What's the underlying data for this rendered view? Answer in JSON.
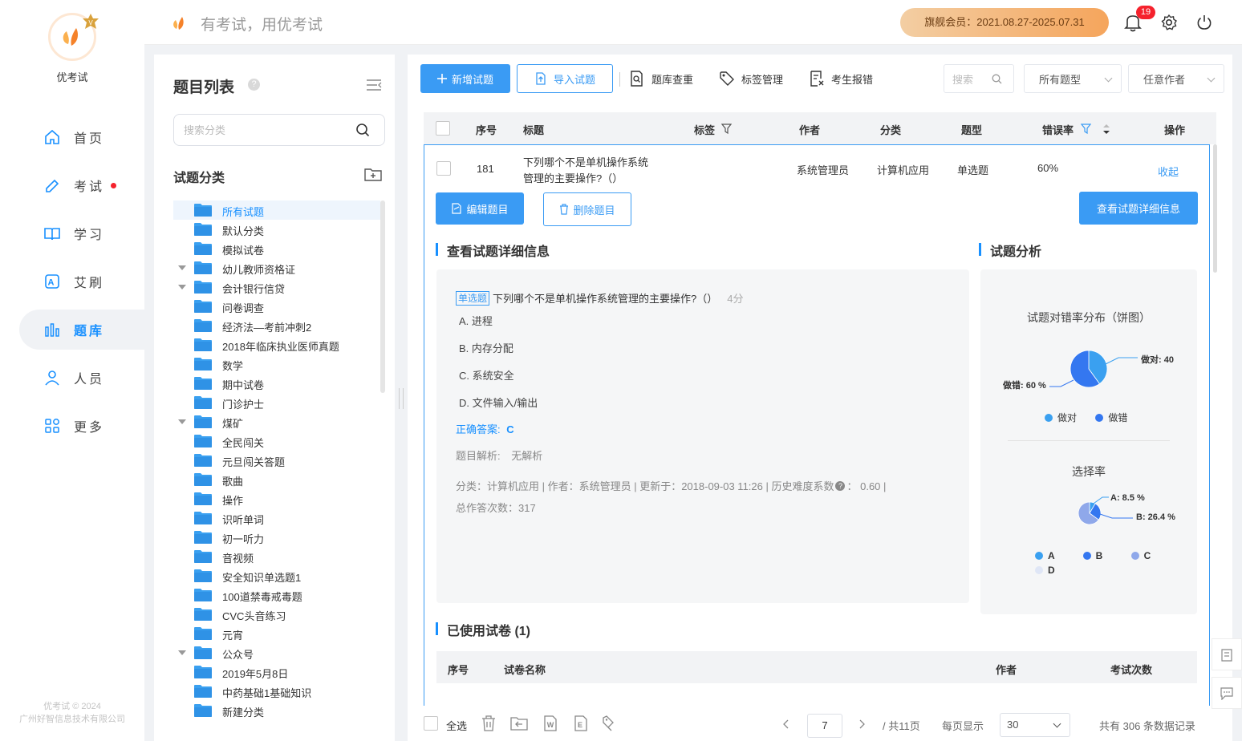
{
  "app": {
    "name": "优考试",
    "slogan": "有考试，用优考试",
    "copyright_line1": "优考试 © 2024",
    "copyright_line2": "广州好智信息技术有限公司"
  },
  "colors": {
    "primary": "#3a9bf4",
    "accent_blue": "#1890ff",
    "danger": "#f5222d",
    "member_gradient_start": "#f3cea3",
    "member_gradient_end": "#f5a55c"
  },
  "nav": {
    "items": [
      {
        "label": "首页",
        "icon": "home-icon"
      },
      {
        "label": "考试",
        "icon": "exam-icon",
        "dot": true
      },
      {
        "label": "学习",
        "icon": "book-icon"
      },
      {
        "label": "艾刷",
        "icon": "a-badge-icon"
      },
      {
        "label": "题库",
        "icon": "bar-chart-icon",
        "active": true
      },
      {
        "label": "人员",
        "icon": "user-icon"
      },
      {
        "label": "更多",
        "icon": "grid-icon"
      }
    ]
  },
  "header": {
    "member_label": "旗舰会员：2021.08.27-2025.07.31",
    "notification_count": "19"
  },
  "catpanel": {
    "title": "题目列表",
    "help": "?",
    "search_placeholder": "搜索分类",
    "section_title": "试题分类",
    "categories": [
      {
        "label": "所有试题",
        "selected": true
      },
      {
        "label": "默认分类"
      },
      {
        "label": "模拟试卷"
      },
      {
        "label": "幼儿教师资格证",
        "expandable": true
      },
      {
        "label": "会计银行信贷",
        "expandable": true
      },
      {
        "label": "问卷调查"
      },
      {
        "label": "经济法—考前冲刺2"
      },
      {
        "label": "2018年临床执业医师真题"
      },
      {
        "label": "数学"
      },
      {
        "label": "期中试卷"
      },
      {
        "label": "门诊护士"
      },
      {
        "label": "煤矿",
        "expandable": true
      },
      {
        "label": "全民闯关"
      },
      {
        "label": "元旦闯关答题"
      },
      {
        "label": "歌曲"
      },
      {
        "label": "操作"
      },
      {
        "label": "识听单词"
      },
      {
        "label": "初一听力"
      },
      {
        "label": "音视频"
      },
      {
        "label": "安全知识单选题1"
      },
      {
        "label": "100道禁毒戒毒题"
      },
      {
        "label": "CVC头音练习"
      },
      {
        "label": "元宵"
      },
      {
        "label": "公众号",
        "expandable": true
      },
      {
        "label": "2019年5月8日"
      },
      {
        "label": "中药基础1基础知识"
      },
      {
        "label": "新建分类"
      }
    ]
  },
  "toolbar": {
    "add": "新增试题",
    "import": "导入试题",
    "dedupe": "题库查重",
    "tags": "标签管理",
    "report": "考生报错",
    "search_placeholder": "搜索",
    "type_filter": "所有题型",
    "author_filter": "任意作者"
  },
  "table": {
    "headers": {
      "index": "序号",
      "title": "标题",
      "tags": "标签",
      "author": "作者",
      "category": "分类",
      "type": "题型",
      "error_rate": "错误率",
      "action": "操作"
    },
    "row": {
      "index": "181",
      "title_line1": "下列哪个不是单机操作系统",
      "title_line2": "管理的主要操作?（）",
      "author": "系统管理员",
      "category": "计算机应用",
      "type": "单选题",
      "error_rate": "60%",
      "action": "收起"
    }
  },
  "detail": {
    "edit_btn": "编辑题目",
    "delete_btn": "删除题目",
    "view_btn": "查看试题详细信息",
    "section_title": "查看试题详细信息",
    "type_tag": "单选题",
    "question": "下列哪个不是单机操作系统管理的主要操作?（）",
    "score": "4分",
    "options": [
      "A. 进程",
      "B. 内存分配",
      "C. 系统安全",
      "D. 文件输入/输出"
    ],
    "answer_label": "正确答案:",
    "answer_value": "C",
    "analysis_label": "题目解析:",
    "analysis_value": "无解析",
    "meta_line1": "分类：计算机应用 | 作者：系统管理员 | 更新于：2018-09-03 11:26 | 历史难度系数",
    "meta_difficulty": "：  0.60 |",
    "meta_line2": "总作答次数：317"
  },
  "analysis": {
    "section_title": "试题分析",
    "pie1_title": "试题对错率分布（饼图）",
    "pie1_label_correct": "做对: 40",
    "pie1_label_wrong": "做错: 60 %",
    "pie1_legend": [
      "做对",
      "做错"
    ],
    "pie2_title": "选择率",
    "pie2_label_a": "A: 8.5 %",
    "pie2_label_b": "B: 26.4 %",
    "pie2_legend": [
      "A",
      "B",
      "C",
      "D"
    ]
  },
  "chart_data": [
    {
      "type": "pie",
      "title": "试题对错率分布（饼图）",
      "categories": [
        "做对",
        "做错"
      ],
      "values": [
        40,
        60
      ],
      "colors": [
        "#3aa0f0",
        "#3477f0"
      ]
    },
    {
      "type": "pie",
      "title": "选择率",
      "categories": [
        "A",
        "B",
        "C",
        "D"
      ],
      "values": [
        8.5,
        26.4,
        65.1,
        0
      ],
      "colors": [
        "#3aa0f0",
        "#3477f0",
        "#8fa8ea",
        "#dfe6f6"
      ]
    }
  ],
  "used": {
    "section_title": "已使用试卷 (1)",
    "headers": {
      "index": "序号",
      "name": "试卷名称",
      "author": "作者",
      "count": "考试次数"
    }
  },
  "footer": {
    "select_all": "全选",
    "page": "7",
    "total_pages": "/ 共11页",
    "per_page_label": "每页显示",
    "per_page": "30",
    "total_records": "共有 306 条数据记录"
  }
}
